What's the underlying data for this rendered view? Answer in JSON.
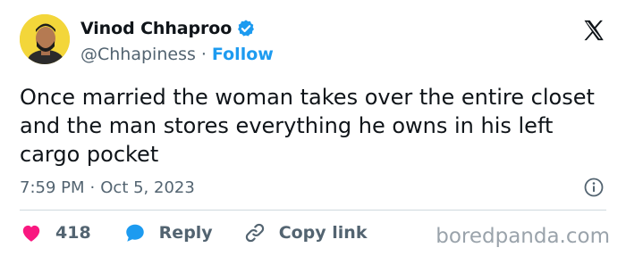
{
  "author": {
    "name": "Vinod Chhaproo",
    "handle": "@Chhapiness",
    "separator": "·",
    "follow_label": "Follow"
  },
  "tweet": {
    "text": "Once married the woman takes over the entire closet and the man stores everything he owns in his left cargo pocket"
  },
  "meta": {
    "time": "7:59 PM",
    "separator": "·",
    "date": "Oct 5, 2023"
  },
  "actions": {
    "likes_count": "418",
    "reply_label": "Reply",
    "copy_label": "Copy link"
  },
  "watermark": "boredpanda.com",
  "icons": {
    "verified": "verified-badge-icon",
    "platform": "x-logo-icon",
    "info": "info-icon",
    "like": "heart-icon",
    "reply": "speech-bubble-icon",
    "copy": "link-icon"
  },
  "colors": {
    "accent": "#1d9bf0",
    "like": "#f91880",
    "text": "#0f1419",
    "muted": "#536471",
    "avatar_bg": "#f3d63a"
  }
}
